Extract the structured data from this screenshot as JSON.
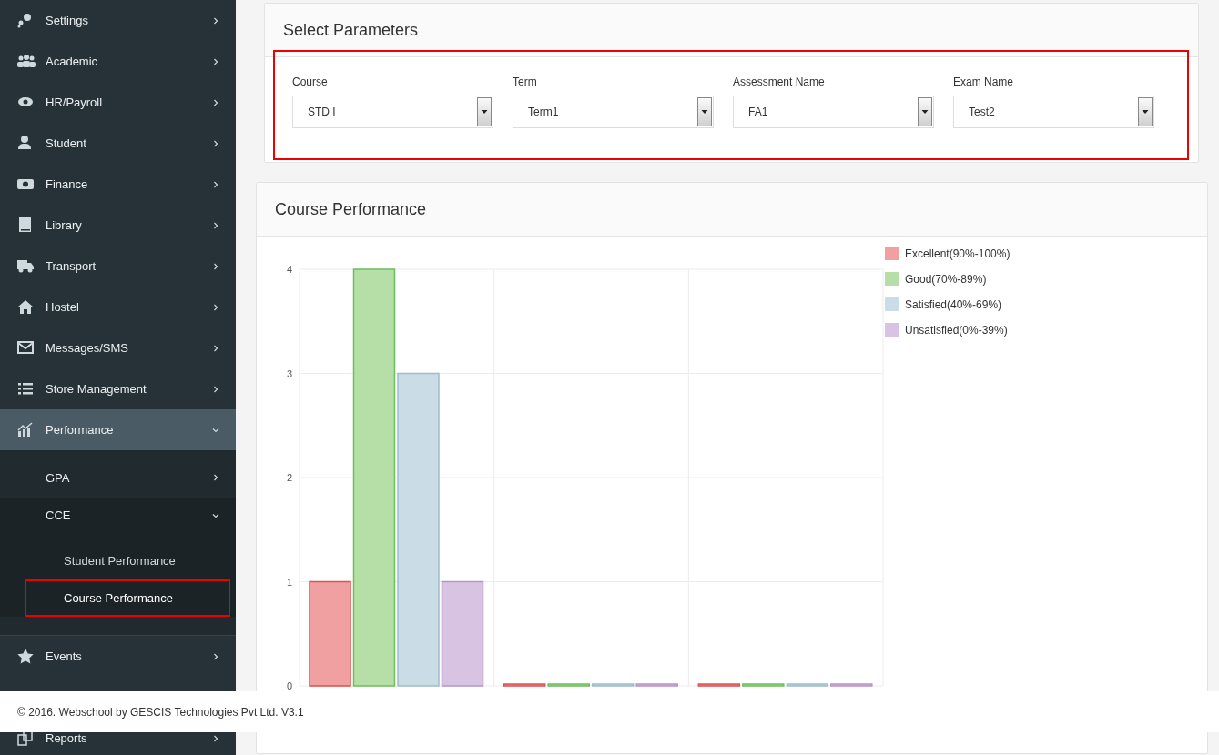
{
  "sidebar": {
    "items": [
      {
        "label": "Settings",
        "expanded": false,
        "selected": false
      },
      {
        "label": "Academic",
        "expanded": false,
        "selected": false
      },
      {
        "label": "HR/Payroll",
        "expanded": false,
        "selected": false
      },
      {
        "label": "Student",
        "expanded": false,
        "selected": false
      },
      {
        "label": "Finance",
        "expanded": false,
        "selected": false
      },
      {
        "label": "Library",
        "expanded": false,
        "selected": false
      },
      {
        "label": "Transport",
        "expanded": false,
        "selected": false
      },
      {
        "label": "Hostel",
        "expanded": false,
        "selected": false
      },
      {
        "label": "Messages/SMS",
        "expanded": false,
        "selected": false
      },
      {
        "label": "Store Management",
        "expanded": false,
        "selected": false
      },
      {
        "label": "Performance",
        "expanded": true,
        "selected": true,
        "children": [
          {
            "label": "GPA",
            "expanded": false,
            "selected": false
          },
          {
            "label": "CCE",
            "expanded": true,
            "selected": false,
            "children": [
              {
                "label": "Student Performance",
                "selected": false
              },
              {
                "label": "Course Performance",
                "selected": true
              }
            ]
          }
        ]
      },
      {
        "label": "Events",
        "expanded": false,
        "selected": false
      },
      {
        "label": "Reports",
        "expanded": false,
        "selected": false
      }
    ]
  },
  "parameters": {
    "title": "Select Parameters",
    "highlighted": true,
    "fields": [
      {
        "label": "Course",
        "value": "STD I"
      },
      {
        "label": "Term",
        "value": "Term1"
      },
      {
        "label": "Assessment Name",
        "value": "FA1"
      },
      {
        "label": "Exam Name",
        "value": "Test2"
      }
    ]
  },
  "performance": {
    "title": "Course Performance",
    "chart_data": {
      "type": "bar",
      "grid": true,
      "ylim": [
        0,
        4
      ],
      "yticks": [
        0,
        1,
        2,
        3,
        4
      ],
      "series": [
        {
          "name": "Excellent(90%-100%)",
          "color": "#f0a0a0",
          "values": [
            1,
            0,
            0
          ]
        },
        {
          "name": "Good(70%-89%)",
          "color": "#b6dfa8",
          "values": [
            4,
            0,
            0
          ]
        },
        {
          "name": "Satisfied(40%-69%)",
          "color": "#cadde7",
          "values": [
            3,
            0,
            0
          ]
        },
        {
          "name": "Unsatisfied(0%-39%)",
          "color": "#d9c3e2",
          "values": [
            1,
            0,
            0
          ]
        }
      ]
    }
  },
  "footer": "© 2016. Webschool by GESCIS Technologies Pvt Ltd. V3.1"
}
